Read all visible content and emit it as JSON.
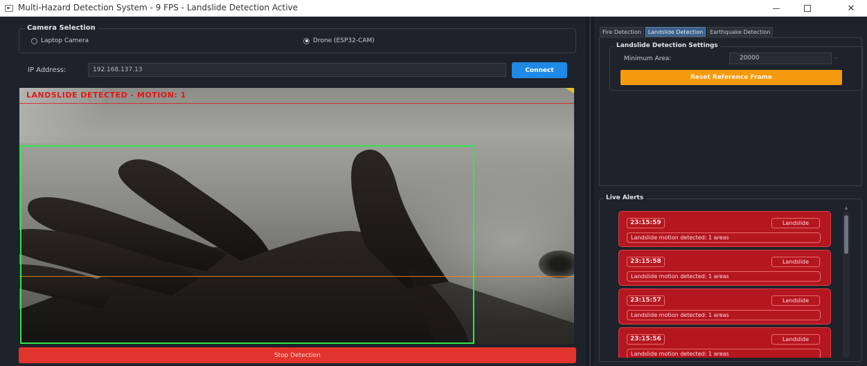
{
  "window": {
    "title": "Multi-Hazard Detection System - 9 FPS - Landslide Detection Active",
    "minimize_glyph": "—",
    "close_glyph": "✕"
  },
  "camera_selection": {
    "title": "Camera Selection",
    "options": [
      {
        "label": "Laptop Camera",
        "selected": false
      },
      {
        "label": "Drone (ESP32-CAM)",
        "selected": true
      }
    ]
  },
  "ip": {
    "label": "IP Address:",
    "value": "192.168.137.13",
    "connect_label": "Connect"
  },
  "video": {
    "overlay_text": "LANDSLIDE DETECTED - MOTION: 1"
  },
  "stop_label": "Stop Detection",
  "tabs": [
    {
      "label": "Fire Detection",
      "active": false
    },
    {
      "label": "Landslide Detection",
      "active": true
    },
    {
      "label": "Earthquake Detection",
      "active": false
    }
  ],
  "settings": {
    "title": "Landslide Detection Settings",
    "min_area_label": "Minimum Area:",
    "min_area_value": "20000",
    "reset_label": "Reset Reference Frame"
  },
  "alerts": {
    "title": "Live Alerts",
    "items": [
      {
        "time": "23:15:59",
        "type": "Landslide",
        "message": "Landslide motion detected: 1 areas"
      },
      {
        "time": "23:15:58",
        "type": "Landslide",
        "message": "Landslide motion detected: 1 areas"
      },
      {
        "time": "23:15:57",
        "type": "Landslide",
        "message": "Landslide motion detected: 1 areas"
      },
      {
        "time": "23:15:56",
        "type": "Landslide",
        "message": "Landslide motion detected: 1 areas"
      }
    ]
  },
  "colors": {
    "accent_blue": "#1e8ae6",
    "stop_red": "#e0342c",
    "reset_orange": "#f59a0e",
    "alert_red": "#b4171f",
    "bbox_green": "#2ee84a"
  },
  "icons": {
    "app": "window-icon",
    "minimize": "minimize-icon",
    "maximize": "maximize-icon",
    "close": "close-icon"
  }
}
